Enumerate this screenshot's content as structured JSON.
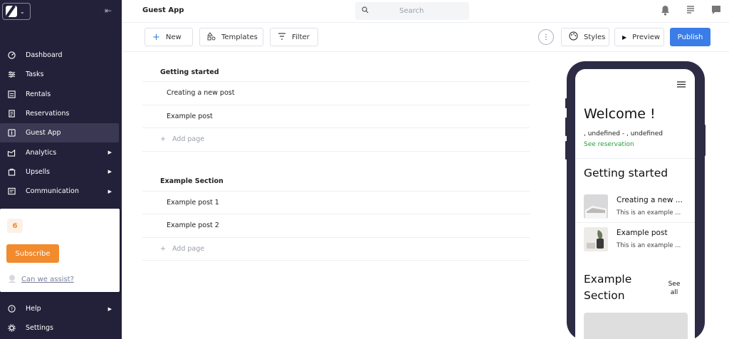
{
  "sidebar": {
    "nav": [
      {
        "label": "Dashboard",
        "icon": "dashboard-icon"
      },
      {
        "label": "Tasks",
        "icon": "tasks-icon"
      },
      {
        "label": "Rentals",
        "icon": "rentals-icon"
      },
      {
        "label": "Reservations",
        "icon": "reservations-icon"
      },
      {
        "label": "Guest App",
        "icon": "guest-app-icon",
        "active": true
      },
      {
        "label": "Analytics",
        "icon": "analytics-icon",
        "has_submenu": true
      },
      {
        "label": "Upsells",
        "icon": "upsells-icon",
        "has_submenu": true
      },
      {
        "label": "Communication",
        "icon": "communication-icon",
        "has_submenu": true
      }
    ],
    "promo": {
      "badge": "6",
      "subscribe_label": "Subscribe",
      "assist_label": "Can we assist?"
    },
    "bottom": [
      {
        "label": "Help",
        "icon": "help-icon",
        "has_submenu": true
      },
      {
        "label": "Settings",
        "icon": "settings-icon"
      }
    ]
  },
  "topbar": {
    "title": "Guest App",
    "search_placeholder": "Search"
  },
  "toolbar": {
    "new_label": "New",
    "templates_label": "Templates",
    "filter_label": "Filter",
    "styles_label": "Styles",
    "preview_label": "Preview",
    "publish_label": "Publish"
  },
  "sections": [
    {
      "title": "Getting started",
      "pages": [
        "Creating a new post",
        "Example post"
      ],
      "add_label": "Add page"
    },
    {
      "title": "Example Section",
      "pages": [
        "Example post 1",
        "Example post 2"
      ],
      "add_label": "Add page"
    }
  ],
  "preview": {
    "welcome": "Welcome !",
    "dates": ", undefined - , undefined",
    "see_reservation": "See reservation",
    "section1_title": "Getting started",
    "cards": [
      {
        "title": "Creating a new ...",
        "subtitle": "This is an example ..."
      },
      {
        "title": "Example post",
        "subtitle": "This is an example ..."
      }
    ],
    "section2_title": "Example Section",
    "see_all": "See all"
  },
  "colors": {
    "sidebar_bg": "#23213a",
    "accent_orange": "#f28a2e",
    "publish_blue": "#3b7de6",
    "link_green": "#2a9d3c"
  }
}
